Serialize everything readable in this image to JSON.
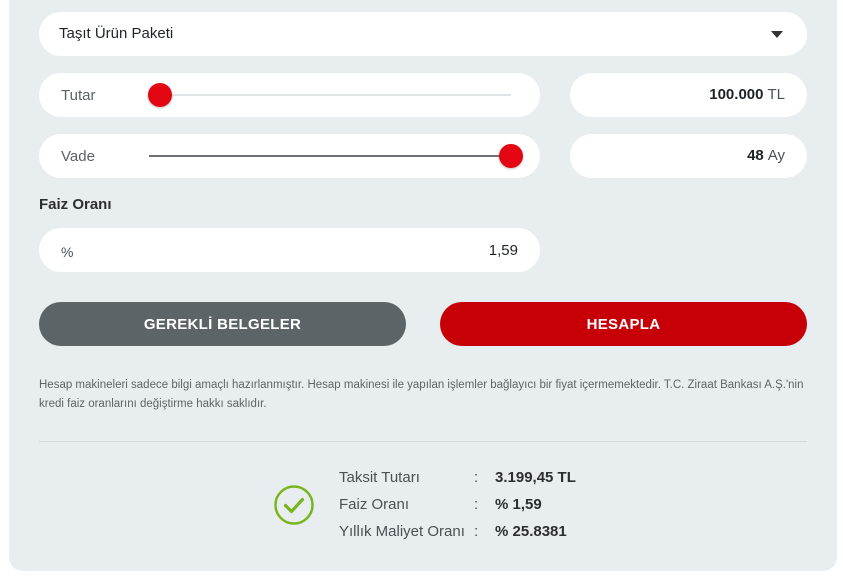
{
  "product": {
    "selected": "Taşıt Ürün Paketi"
  },
  "amount": {
    "label": "Tutar",
    "value": "100.000",
    "unit": "TL",
    "slider_level": 0.03
  },
  "term": {
    "label": "Vade",
    "value": "48",
    "unit": "Ay",
    "slider_level": 1.0
  },
  "interest": {
    "title": "Faiz Oranı",
    "prefix": "%",
    "value": "1,59"
  },
  "buttons": {
    "documents": "GEREKLİ BELGELER",
    "calculate": "HESAPLA"
  },
  "disclaimer": "Hesap makineleri sadece bilgi amaçlı hazırlanmıştır. Hesap makinesi ile yapılan işlemler bağlayıcı bir fiyat içermemektedir. T.C. Ziraat Bankası A.Ş.'nin kredi faiz oranlarını değiştirme hakkı saklıdır.",
  "results": [
    {
      "label": "Taksit Tutarı",
      "value": "3.199,45 TL"
    },
    {
      "label": "Faiz Oranı",
      "value": "% 1,59"
    },
    {
      "label": "Yıllık Maliyet Oranı",
      "value": "% 25.8381"
    }
  ],
  "colors": {
    "accent": "#c70008",
    "knob": "#e30613",
    "success": "#7ab51d",
    "secondary": "#5c6468"
  }
}
